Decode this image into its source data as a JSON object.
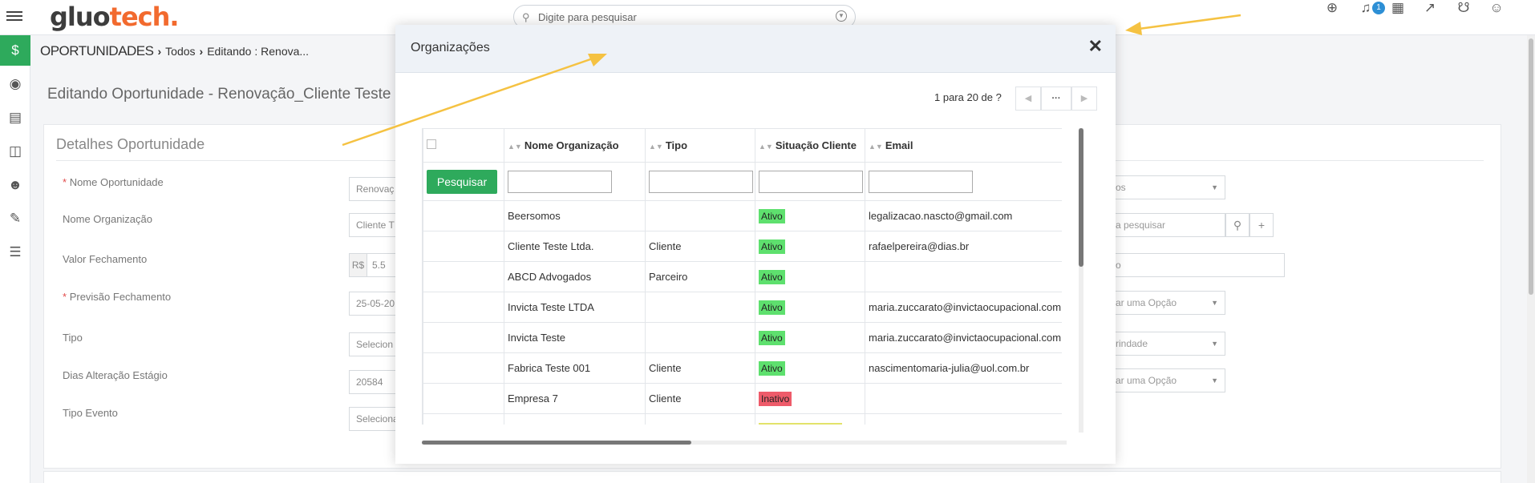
{
  "brand": {
    "logo_part1": "gluo",
    "logo_part2": "tech."
  },
  "search": {
    "placeholder": "Digite para pesquisar"
  },
  "topbar": {
    "notification_count": "1"
  },
  "breadcrumb": {
    "root": "OPORTUNIDADES",
    "level1": "Todos",
    "level2": "Editando : Renova..."
  },
  "page": {
    "title": "Editando Oportunidade - Renovação_Cliente Teste"
  },
  "details": {
    "title": "Detalhes Oportunidade",
    "fields": [
      {
        "label": "Nome Oportunidade",
        "required": "*",
        "value": "Renovaç"
      },
      {
        "label": "Nome Organização",
        "required": "",
        "value": "Cliente T"
      },
      {
        "label": "Valor Fechamento",
        "required": "",
        "currency": "R$",
        "value": "5.5"
      },
      {
        "label": "Previsão Fechamento",
        "required": "*",
        "value": "25-05-20"
      },
      {
        "label": "Tipo",
        "required": "",
        "value": "Selecion"
      },
      {
        "label": "Dias Alteração Estágio",
        "required": "",
        "value": "20584"
      },
      {
        "label": "Tipo Evento",
        "required": "",
        "value": "Seleciona"
      }
    ],
    "right_fields": [
      "os",
      "a pesquisar",
      "o",
      "ar uma Opção",
      "rindade",
      "ar uma Opção"
    ]
  },
  "modal": {
    "title": "Organizações",
    "pager_text": "1 para 20  de ?",
    "pager_more": "···",
    "search_button": "Pesquisar",
    "columns": [
      "Nome Organização",
      "Tipo",
      "Situação Cliente",
      "Email"
    ],
    "rows": [
      {
        "name": "Beersomos",
        "tipo": "",
        "situacao": "Ativo",
        "email": "legalizacao.nascto@gmail.com"
      },
      {
        "name": "Cliente Teste Ltda.",
        "tipo": "Cliente",
        "situacao": "Ativo",
        "email": "rafaelpereira@dias.br"
      },
      {
        "name": "ABCD Advogados",
        "tipo": "Parceiro",
        "situacao": "Ativo",
        "email": ""
      },
      {
        "name": "Invicta Teste LTDA",
        "tipo": "",
        "situacao": "Ativo",
        "email": "maria.zuccarato@invictaocupacional.com.br"
      },
      {
        "name": "Invicta Teste",
        "tipo": "",
        "situacao": "Ativo",
        "email": "maria.zuccarato@invictaocupacional.com.br"
      },
      {
        "name": "Fabrica Teste 001",
        "tipo": "Cliente",
        "situacao": "Ativo",
        "email": "nascimentomaria-julia@uol.com.br"
      },
      {
        "name": "Empresa 7",
        "tipo": "Cliente",
        "situacao": "Inativo",
        "email": ""
      }
    ]
  },
  "colors": {
    "accent": "#2eaa5c",
    "ativo": "#5ee06e",
    "inativo": "#ee5b6a",
    "logo_orange": "#f26a2e",
    "arrow": "#f5c242"
  }
}
